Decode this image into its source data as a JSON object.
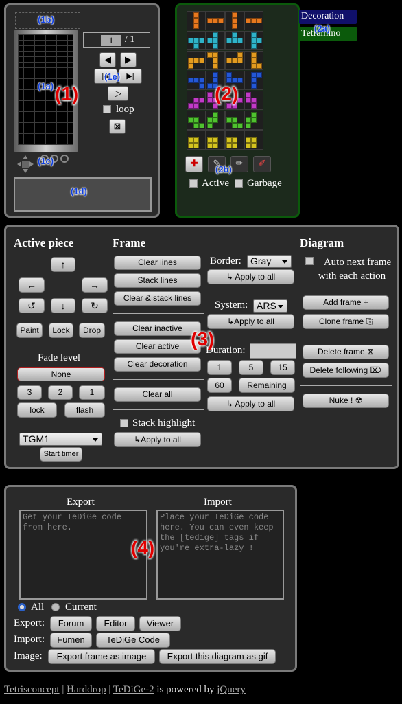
{
  "markers": {
    "m1": "(1)",
    "m1a": "(1a)",
    "m1b": "(1b)",
    "m1c": "(1c)",
    "m1d": "(1d)",
    "m1e": "(1e)",
    "m2": "(2)",
    "m2a": "(2a)",
    "m2b": "(2b)",
    "m3": "(3)",
    "m4": "(4)"
  },
  "viewer": {
    "frame_current": "1",
    "frame_total": "/ 1",
    "loop_label": "loop",
    "prev": "◀",
    "next": "▶",
    "first": "|◀",
    "last": "▶|",
    "play": "▷",
    "delete": "⊠"
  },
  "palette": {
    "tab_decoration": "Decoration",
    "tab_tetramino": "Tetramino",
    "active_label": "Active",
    "garbage_label": "Garbage",
    "colors": [
      "#e8781e",
      "#2fb3c9",
      "#e39b20",
      "#2357d6",
      "#c23ac7",
      "#4fc22f",
      "#d4c21f"
    ]
  },
  "active_piece": {
    "heading": "Active piece",
    "up": "↑",
    "left": "←",
    "right": "→",
    "down": "↓",
    "rot_ccw": "↺",
    "rot_cw": "↻",
    "paint": "Paint",
    "lock": "Lock",
    "drop": "Drop",
    "fade_heading": "Fade level",
    "fade_none": "None",
    "fade_3": "3",
    "fade_2": "2",
    "fade_1": "1",
    "fade_lock": "lock",
    "fade_flash": "flash",
    "timer_select": "TGM1",
    "start_timer": "Start timer"
  },
  "frame": {
    "heading": "Frame",
    "clear_lines": "Clear lines",
    "stack_lines": "Stack lines",
    "clear_stack_lines": "Clear & stack lines",
    "clear_inactive": "Clear inactive",
    "clear_active": "Clear active",
    "clear_decoration": "Clear decoration",
    "clear_all": "Clear all",
    "stack_highlight": "Stack highlight",
    "apply_to_all": "↳Apply to all"
  },
  "settings": {
    "border_label": "Border:",
    "border_value": "Gray",
    "border_apply": "↳ Apply to all",
    "system_label": "System:",
    "system_value": "ARS",
    "system_apply": "↳Apply to all",
    "duration_label": "Duration:",
    "d1": "1",
    "d5": "5",
    "d15": "15",
    "d60": "60",
    "remaining": "Remaining",
    "duration_apply": "↳ Apply to all"
  },
  "diagram": {
    "heading": "Diagram",
    "auto_next": "Auto next frame with each action",
    "add_frame": "Add frame +",
    "clone_frame": "Clone frame ⎘",
    "delete_frame": "Delete frame ⊠",
    "delete_following": "Delete following ⌦",
    "nuke": "Nuke ! ☢"
  },
  "io": {
    "export_heading": "Export",
    "import_heading": "Import",
    "export_placeholder": "Get your TeDiGe code from here.",
    "import_placeholder": "Place your TeDiGe code here. You can even keep the [tedige] tags if you're extra-lazy !",
    "all_label": "All",
    "current_label": "Current",
    "export_row": "Export:",
    "forum": "Forum",
    "editor": "Editor",
    "viewer": "Viewer",
    "import_row": "Import:",
    "fumen": "Fumen",
    "tedige_code": "TeDiGe Code",
    "image_row": "Image:",
    "export_image": "Export frame as image",
    "export_gif": "Export this diagram as gif"
  },
  "footer": {
    "link1": "Tetrisconcept",
    "sep1": "|",
    "link2": "Harddrop",
    "sep2": "|",
    "link3": "TeDiGe-2",
    "powered": "is powered by",
    "link4": "jQuery"
  }
}
